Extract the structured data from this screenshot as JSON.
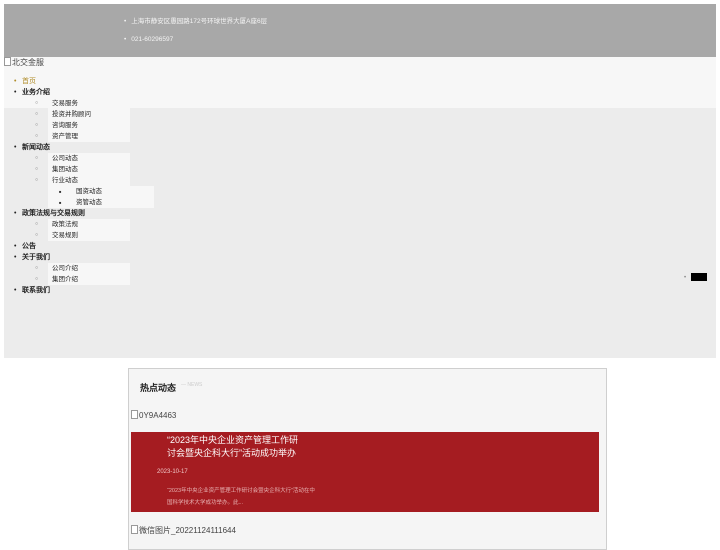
{
  "topbar": {
    "address": "上海市静安区愚园路172号环球世界大厦A座6层",
    "phone": "021-60296597"
  },
  "logo": {
    "alt": "北交金服"
  },
  "nav": {
    "home": "首页",
    "business": {
      "label": "业务介绍",
      "items": [
        "交易服务",
        "投资并购顾问",
        "咨询服务",
        "资产管理"
      ]
    },
    "news": {
      "label": "新闻动态",
      "items": [
        "公司动态",
        "集团动态",
        "行业动态"
      ],
      "industry_sub": [
        "国资动态",
        "资管动态"
      ]
    },
    "policy": {
      "label": "政策法规与交易规则",
      "items": [
        "政策法规",
        "交易规则"
      ]
    },
    "notice": "公告",
    "about": {
      "label": "关于我们",
      "items": [
        "公司介绍",
        "集团介绍"
      ]
    },
    "contact": "联系我们"
  },
  "hot": {
    "title": "热点动态",
    "title_en": "— NEWS",
    "img1_alt": "0Y9A4463",
    "card": {
      "title": "“2023年中央企业资产管理工作研讨会暨央企科大行”活动成功举办",
      "date": "2023-10-17",
      "desc": "“2023年中央企业资产管理工作研讨会暨央企科大行”活动在中国科学技术大学成功举办。此..."
    },
    "img2_alt": "微信图片_20221124111644"
  },
  "colors": {
    "accent_red": "#a51c21",
    "active_gold": "#b08d2a",
    "topbar": "#a8a8a8"
  }
}
